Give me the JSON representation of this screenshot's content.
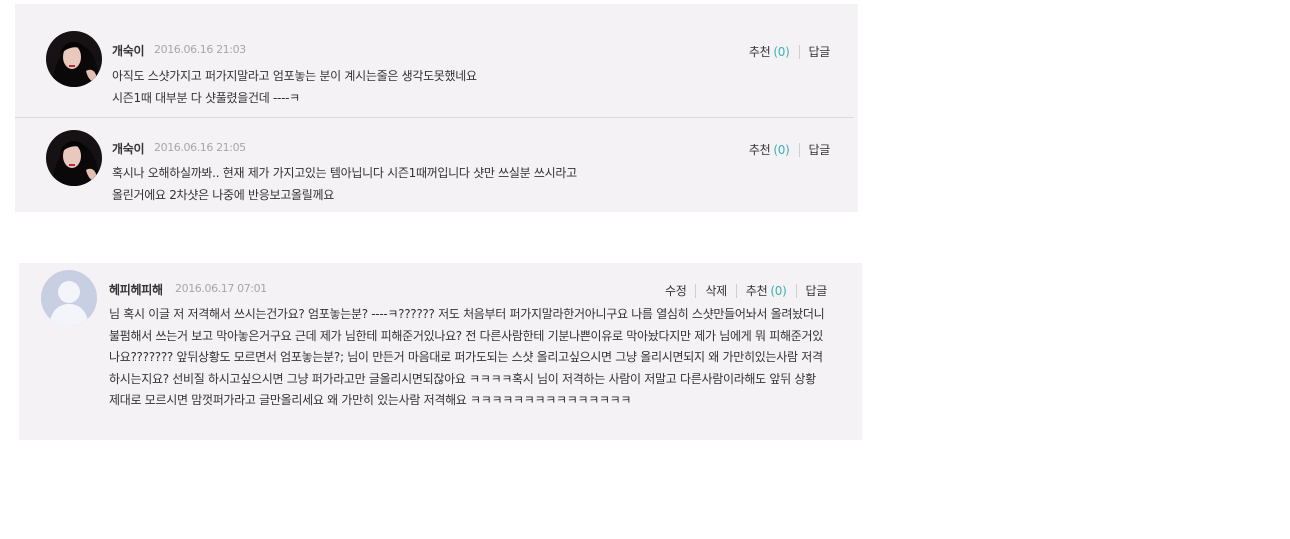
{
  "colors": {
    "panel_bg": "#f5f2f5",
    "count_color": "#3bb0b5",
    "date_color": "#a7a7a7"
  },
  "comments": [
    {
      "author": "개숙이",
      "date": "2016.06.16 21:03",
      "body_lines": [
        "아직도 스샷가지고 퍼가지말라고 엄포놓는 분이 계시는줄은 생각도못했네요",
        "시즌1때 대부분 다 샷풀렸을건데 ----ㅋ"
      ],
      "recommend_label": "추천",
      "recommend_count": "(0)",
      "reply_label": "답글"
    },
    {
      "author": "개숙이",
      "date": "2016.06.16 21:05",
      "body_lines": [
        "혹시나 오해하실까봐.. 현재 제가 가지고있는 템아닙니다 시즌1때꺼입니다 샷만 쓰실분 쓰시라고",
        "올린거에요 2차샷은 나중에 반응보고올릴께요"
      ],
      "recommend_label": "추천",
      "recommend_count": "(0)",
      "reply_label": "답글"
    },
    {
      "author": "헤피헤피해",
      "date": "2016.06.17 07:01",
      "body": "님 혹시 이글 저 저격해서 쓰시는건가요? 엄포놓는분? ----ㅋ?????? 저도 처음부터 퍼가지말라한거아니구요 나름 열심히 스샷만들어놔서 올려놨더니 불펌해서 쓰는거 보고 막아놓은거구요 근데 제가 님한테 피해준거있나요? 전 다른사람한테 기분나쁜이유로 막아놨다지만 제가 님에게 뭐 피해준거있나요??????? 앞뒤상황도 모르면서 엄포놓는분?; 님이 만든거 마음대로 퍼가도되는 스샷 올리고싶으시면 그냥 올리시면되지 왜 가만히있는사람 저격하시는지요? 선비질 하시고싶으시면 그냥 퍼가라고만 글올리시면되잖아요 ㅋㅋㅋㅋ혹시 님이 저격하는 사람이 저말고 다른사람이라해도 앞뒤 상황 제대로 모르시면 맘껏퍼가라고 글만올리세요 왜 가만히 있는사람 저격해요 ㅋㅋㅋㅋㅋㅋㅋㅋㅋㅋㅋㅋㅋㅋㅋ",
      "edit_label": "수정",
      "delete_label": "삭제",
      "recommend_label": "추천",
      "recommend_count": "(0)",
      "reply_label": "답글"
    }
  ]
}
